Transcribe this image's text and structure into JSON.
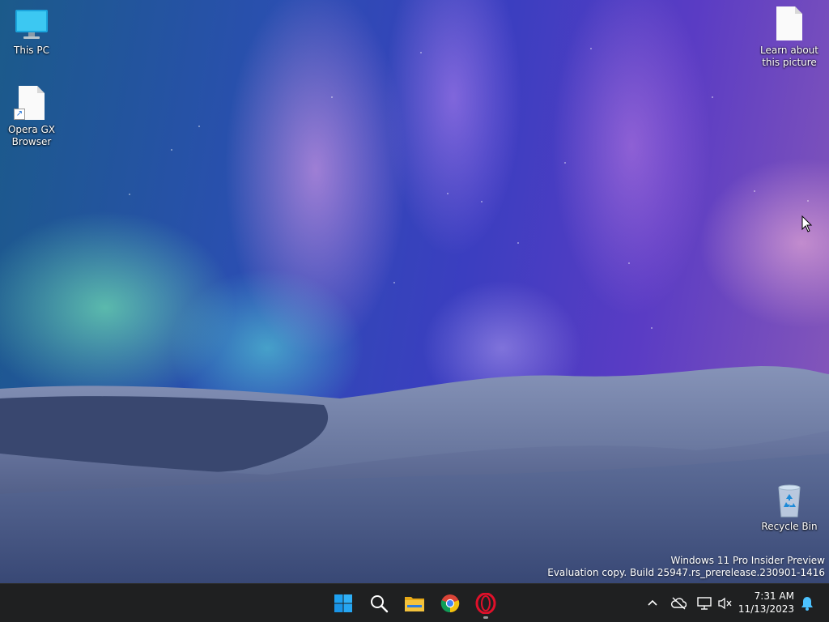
{
  "desktop": {
    "icons": [
      {
        "label": "This PC",
        "icon": "monitor-icon"
      },
      {
        "label": "Opera GX Browser",
        "icon": "document-shortcut-icon"
      },
      {
        "label": "Learn about this picture",
        "icon": "document-icon"
      },
      {
        "label": "Recycle Bin",
        "icon": "recycle-bin-icon"
      }
    ],
    "watermark": {
      "line1": "Windows 11 Pro Insider Preview",
      "line2": "Evaluation copy. Build 25947.rs_prerelease.230901-1416"
    }
  },
  "taskbar": {
    "apps": [
      {
        "name": "Start",
        "icon": "windows-start-icon"
      },
      {
        "name": "Search",
        "icon": "search-icon"
      },
      {
        "name": "File Explorer",
        "icon": "folder-icon"
      },
      {
        "name": "Google Chrome",
        "icon": "chrome-icon"
      },
      {
        "name": "Opera GX",
        "icon": "opera-icon",
        "running": true
      }
    ],
    "tray": {
      "icons": [
        "chevron-up-icon",
        "cloud-offline-icon",
        "network-icon",
        "volume-muted-icon",
        "notification-bell-icon"
      ],
      "time": "7:31 AM",
      "date": "11/13/2023"
    }
  },
  "colors": {
    "taskbar_bg": "#1f2021",
    "windows_blue": "#1ea1f1",
    "opera_red": "#e0102a",
    "folder_yellow": "#f3c23c",
    "notification_blue": "#4cc2ff"
  }
}
